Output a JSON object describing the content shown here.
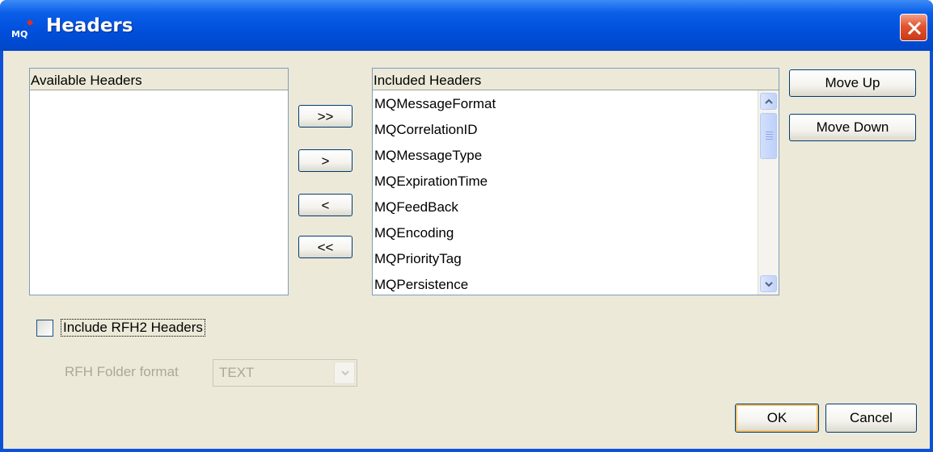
{
  "window": {
    "title": "Headers",
    "app_icon_text": "MQ",
    "close_icon": "close-icon",
    "colors": {
      "titlebar": "#0050dc",
      "client": "#ece9d8",
      "close": "#e2552e"
    }
  },
  "available_headers": {
    "header": "Available Headers",
    "items": []
  },
  "transfer_buttons": {
    "add_all": ">>",
    "add": ">",
    "remove": "<",
    "remove_all": "<<"
  },
  "included_headers": {
    "header": "Included Headers",
    "items": [
      "MQMessageFormat",
      "MQCorrelationID",
      "MQMessageType",
      "MQExpirationTime",
      "MQFeedBack",
      "MQEncoding",
      "MQPriorityTag",
      "MQPersistence"
    ]
  },
  "order_buttons": {
    "move_up": "Move Up",
    "move_down": "Move Down"
  },
  "rfh2": {
    "checkbox_label": "Include RFH2 Headers",
    "checked": false,
    "folder_format_label": "RFH Folder format",
    "folder_format_value": "TEXT"
  },
  "footer": {
    "ok": "OK",
    "cancel": "Cancel"
  }
}
